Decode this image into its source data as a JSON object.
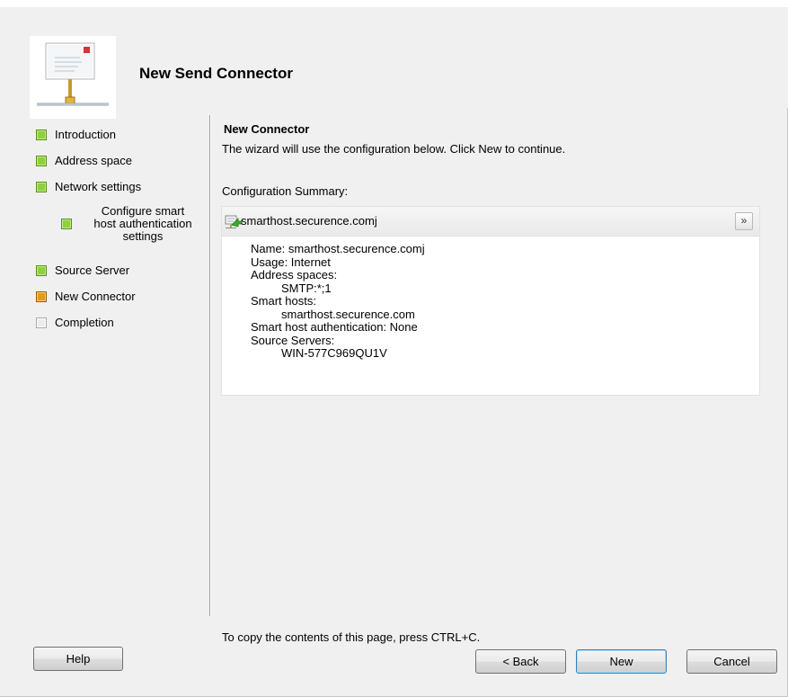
{
  "window": {
    "title": "New Send Connector"
  },
  "nav": {
    "items": [
      {
        "label": "Introduction",
        "state": "done"
      },
      {
        "label": "Address space",
        "state": "done"
      },
      {
        "label": "Network settings",
        "state": "done"
      },
      {
        "label": "Configure smart host authentication settings",
        "state": "done"
      },
      {
        "label": "Source Server",
        "state": "done"
      },
      {
        "label": "New Connector",
        "state": "current"
      },
      {
        "label": "Completion",
        "state": "pending"
      }
    ],
    "sub_item_lines": [
      "Configure smart",
      "host authentication",
      "settings"
    ]
  },
  "content": {
    "title": "New Connector",
    "description": "The wizard will use the configuration below.  Click New to continue.",
    "summary_label": "Configuration Summary:",
    "summary_header": "smarthost.securence.comj",
    "summary_lines": [
      {
        "text": "Name: smarthost.securence.comj",
        "level": 1
      },
      {
        "text": "Usage: Internet",
        "level": 1
      },
      {
        "text": "Address spaces:",
        "level": 1
      },
      {
        "text": "SMTP:*;1",
        "level": 2
      },
      {
        "text": "Smart hosts:",
        "level": 1
      },
      {
        "text": "smarthost.securence.com",
        "level": 2
      },
      {
        "text": "Smart host authentication: None",
        "level": 1
      },
      {
        "text": "Source Servers:",
        "level": 1
      },
      {
        "text": "WIN-577C969QU1V",
        "level": 2
      }
    ],
    "footer_note": "To copy the contents of this page, press CTRL+C."
  },
  "buttons": {
    "help": "Help",
    "back": "< Back",
    "new": "New",
    "cancel": "Cancel"
  },
  "icons": {
    "header": "send-connector-icon",
    "summary": "connector-icon",
    "collapse": "double-chevron-up-icon"
  },
  "colors": {
    "step_done": "#8fd13a",
    "step_current": "#e59a17",
    "step_pending": "#ececec",
    "default_button_border": "#3c7fb1"
  }
}
